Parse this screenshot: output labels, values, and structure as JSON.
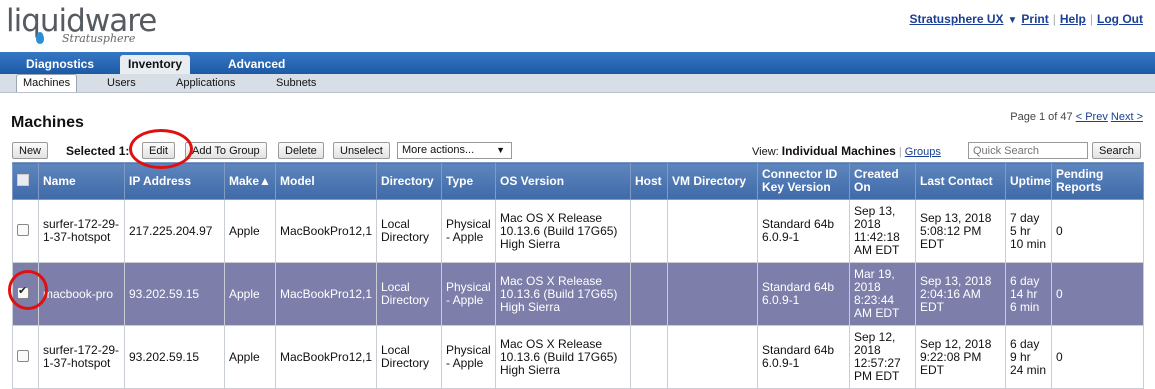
{
  "brand": {
    "logo": "liquidware",
    "sub": "Stratusphere"
  },
  "toplinks": {
    "user": "Stratusphere UX",
    "print": "Print",
    "help": "Help",
    "logout": "Log Out"
  },
  "maintabs": [
    "Diagnostics",
    "Inventory",
    "Advanced"
  ],
  "subtabs": [
    "Machines",
    "Users",
    "Applications",
    "Subnets"
  ],
  "page": {
    "title": "Machines",
    "pager_text": "Page 1 of 47",
    "prev": "< Prev",
    "next": "Next >"
  },
  "toolbar": {
    "new": "New",
    "selected": "Selected 1:",
    "edit": "Edit",
    "add_group": "Add To Group",
    "delete": "Delete",
    "unselect": "Unselect",
    "more_actions": "More actions...",
    "view_prefix": "View:",
    "view_current": "Individual Machines",
    "view_groups": "Groups",
    "quick_search_placeholder": "Quick Search",
    "search": "Search"
  },
  "columns": [
    "Name",
    "IP Address",
    "Make▲",
    "Model",
    "Directory",
    "Type",
    "OS Version",
    "Host",
    "VM Directory",
    "Connector ID Key Version",
    "Created On",
    "Last Contact",
    "Uptime",
    "Pending Reports"
  ],
  "rows": [
    {
      "checked": false,
      "name": "surfer-172-29-1-37-hotspot",
      "ip": "217.225.204.97",
      "make": "Apple",
      "model": "MacBookPro12,1",
      "directory": "Local Directory",
      "type": "Physical - Apple",
      "os": "Mac OS X Release 10.13.6 (Build 17G65) High Sierra",
      "host": "",
      "vmdir": "",
      "connector": "Standard 64b 6.0.9-1",
      "created": "Sep 13, 2018 11:42:18 AM EDT",
      "last": "Sep 13, 2018 5:08:12 PM EDT",
      "uptime": "7 day 5 hr 10 min",
      "pending": "0"
    },
    {
      "checked": true,
      "name": "macbook-pro",
      "ip": "93.202.59.15",
      "make": "Apple",
      "model": "MacBookPro12,1",
      "directory": "Local Directory",
      "type": "Physical - Apple",
      "os": "Mac OS X Release 10.13.6 (Build 17G65) High Sierra",
      "host": "",
      "vmdir": "",
      "connector": "Standard 64b 6.0.9-1",
      "created": "Mar 19, 2018 8:23:44 AM EDT",
      "last": "Sep 13, 2018 2:04:16 AM EDT",
      "uptime": "6 day 14 hr 6 min",
      "pending": "0"
    },
    {
      "checked": false,
      "name": "surfer-172-29-1-37-hotspot",
      "ip": "93.202.59.15",
      "make": "Apple",
      "model": "MacBookPro12,1",
      "directory": "Local Directory",
      "type": "Physical - Apple",
      "os": "Mac OS X Release 10.13.6 (Build 17G65) High Sierra",
      "host": "",
      "vmdir": "",
      "connector": "Standard 64b 6.0.9-1",
      "created": "Sep 12, 2018 12:57:27 PM EDT",
      "last": "Sep 12, 2018 9:22:08 PM EDT",
      "uptime": "6 day 9 hr 24 min",
      "pending": "0"
    }
  ]
}
